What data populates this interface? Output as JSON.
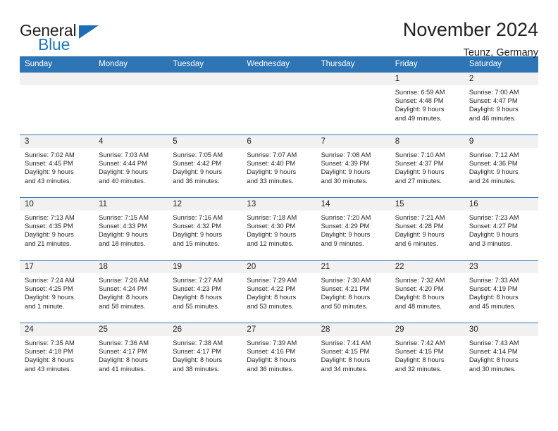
{
  "logo": {
    "word_one": "General",
    "word_two": "Blue",
    "triangle_color": "#1c6fb5",
    "blue_color": "#1f77bf"
  },
  "header": {
    "title": "November 2024",
    "subtitle": "Teunz, Germany"
  },
  "theme": {
    "header_bg": "#2e75b6",
    "daynum_bg": "#f1f1f1",
    "text": "#231f20"
  },
  "calendar": {
    "weekday_headers": [
      "Sunday",
      "Monday",
      "Tuesday",
      "Wednesday",
      "Thursday",
      "Friday",
      "Saturday"
    ],
    "weeks": [
      [
        {
          "day": "",
          "lines": []
        },
        {
          "day": "",
          "lines": []
        },
        {
          "day": "",
          "lines": []
        },
        {
          "day": "",
          "lines": []
        },
        {
          "day": "",
          "lines": []
        },
        {
          "day": "1",
          "lines": [
            "Sunrise: 6:59 AM",
            "Sunset: 4:48 PM",
            "Daylight: 9 hours",
            "and 49 minutes."
          ]
        },
        {
          "day": "2",
          "lines": [
            "Sunrise: 7:00 AM",
            "Sunset: 4:47 PM",
            "Daylight: 9 hours",
            "and 46 minutes."
          ]
        }
      ],
      [
        {
          "day": "3",
          "lines": [
            "Sunrise: 7:02 AM",
            "Sunset: 4:45 PM",
            "Daylight: 9 hours",
            "and 43 minutes."
          ]
        },
        {
          "day": "4",
          "lines": [
            "Sunrise: 7:03 AM",
            "Sunset: 4:44 PM",
            "Daylight: 9 hours",
            "and 40 minutes."
          ]
        },
        {
          "day": "5",
          "lines": [
            "Sunrise: 7:05 AM",
            "Sunset: 4:42 PM",
            "Daylight: 9 hours",
            "and 36 minutes."
          ]
        },
        {
          "day": "6",
          "lines": [
            "Sunrise: 7:07 AM",
            "Sunset: 4:40 PM",
            "Daylight: 9 hours",
            "and 33 minutes."
          ]
        },
        {
          "day": "7",
          "lines": [
            "Sunrise: 7:08 AM",
            "Sunset: 4:39 PM",
            "Daylight: 9 hours",
            "and 30 minutes."
          ]
        },
        {
          "day": "8",
          "lines": [
            "Sunrise: 7:10 AM",
            "Sunset: 4:37 PM",
            "Daylight: 9 hours",
            "and 27 minutes."
          ]
        },
        {
          "day": "9",
          "lines": [
            "Sunrise: 7:12 AM",
            "Sunset: 4:36 PM",
            "Daylight: 9 hours",
            "and 24 minutes."
          ]
        }
      ],
      [
        {
          "day": "10",
          "lines": [
            "Sunrise: 7:13 AM",
            "Sunset: 4:35 PM",
            "Daylight: 9 hours",
            "and 21 minutes."
          ]
        },
        {
          "day": "11",
          "lines": [
            "Sunrise: 7:15 AM",
            "Sunset: 4:33 PM",
            "Daylight: 9 hours",
            "and 18 minutes."
          ]
        },
        {
          "day": "12",
          "lines": [
            "Sunrise: 7:16 AM",
            "Sunset: 4:32 PM",
            "Daylight: 9 hours",
            "and 15 minutes."
          ]
        },
        {
          "day": "13",
          "lines": [
            "Sunrise: 7:18 AM",
            "Sunset: 4:30 PM",
            "Daylight: 9 hours",
            "and 12 minutes."
          ]
        },
        {
          "day": "14",
          "lines": [
            "Sunrise: 7:20 AM",
            "Sunset: 4:29 PM",
            "Daylight: 9 hours",
            "and 9 minutes."
          ]
        },
        {
          "day": "15",
          "lines": [
            "Sunrise: 7:21 AM",
            "Sunset: 4:28 PM",
            "Daylight: 9 hours",
            "and 6 minutes."
          ]
        },
        {
          "day": "16",
          "lines": [
            "Sunrise: 7:23 AM",
            "Sunset: 4:27 PM",
            "Daylight: 9 hours",
            "and 3 minutes."
          ]
        }
      ],
      [
        {
          "day": "17",
          "lines": [
            "Sunrise: 7:24 AM",
            "Sunset: 4:25 PM",
            "Daylight: 9 hours",
            "and 1 minute."
          ]
        },
        {
          "day": "18",
          "lines": [
            "Sunrise: 7:26 AM",
            "Sunset: 4:24 PM",
            "Daylight: 8 hours",
            "and 58 minutes."
          ]
        },
        {
          "day": "19",
          "lines": [
            "Sunrise: 7:27 AM",
            "Sunset: 4:23 PM",
            "Daylight: 8 hours",
            "and 55 minutes."
          ]
        },
        {
          "day": "20",
          "lines": [
            "Sunrise: 7:29 AM",
            "Sunset: 4:22 PM",
            "Daylight: 8 hours",
            "and 53 minutes."
          ]
        },
        {
          "day": "21",
          "lines": [
            "Sunrise: 7:30 AM",
            "Sunset: 4:21 PM",
            "Daylight: 8 hours",
            "and 50 minutes."
          ]
        },
        {
          "day": "22",
          "lines": [
            "Sunrise: 7:32 AM",
            "Sunset: 4:20 PM",
            "Daylight: 8 hours",
            "and 48 minutes."
          ]
        },
        {
          "day": "23",
          "lines": [
            "Sunrise: 7:33 AM",
            "Sunset: 4:19 PM",
            "Daylight: 8 hours",
            "and 45 minutes."
          ]
        }
      ],
      [
        {
          "day": "24",
          "lines": [
            "Sunrise: 7:35 AM",
            "Sunset: 4:18 PM",
            "Daylight: 8 hours",
            "and 43 minutes."
          ]
        },
        {
          "day": "25",
          "lines": [
            "Sunrise: 7:36 AM",
            "Sunset: 4:17 PM",
            "Daylight: 8 hours",
            "and 41 minutes."
          ]
        },
        {
          "day": "26",
          "lines": [
            "Sunrise: 7:38 AM",
            "Sunset: 4:17 PM",
            "Daylight: 8 hours",
            "and 38 minutes."
          ]
        },
        {
          "day": "27",
          "lines": [
            "Sunrise: 7:39 AM",
            "Sunset: 4:16 PM",
            "Daylight: 8 hours",
            "and 36 minutes."
          ]
        },
        {
          "day": "28",
          "lines": [
            "Sunrise: 7:41 AM",
            "Sunset: 4:15 PM",
            "Daylight: 8 hours",
            "and 34 minutes."
          ]
        },
        {
          "day": "29",
          "lines": [
            "Sunrise: 7:42 AM",
            "Sunset: 4:15 PM",
            "Daylight: 8 hours",
            "and 32 minutes."
          ]
        },
        {
          "day": "30",
          "lines": [
            "Sunrise: 7:43 AM",
            "Sunset: 4:14 PM",
            "Daylight: 8 hours",
            "and 30 minutes."
          ]
        }
      ]
    ]
  }
}
